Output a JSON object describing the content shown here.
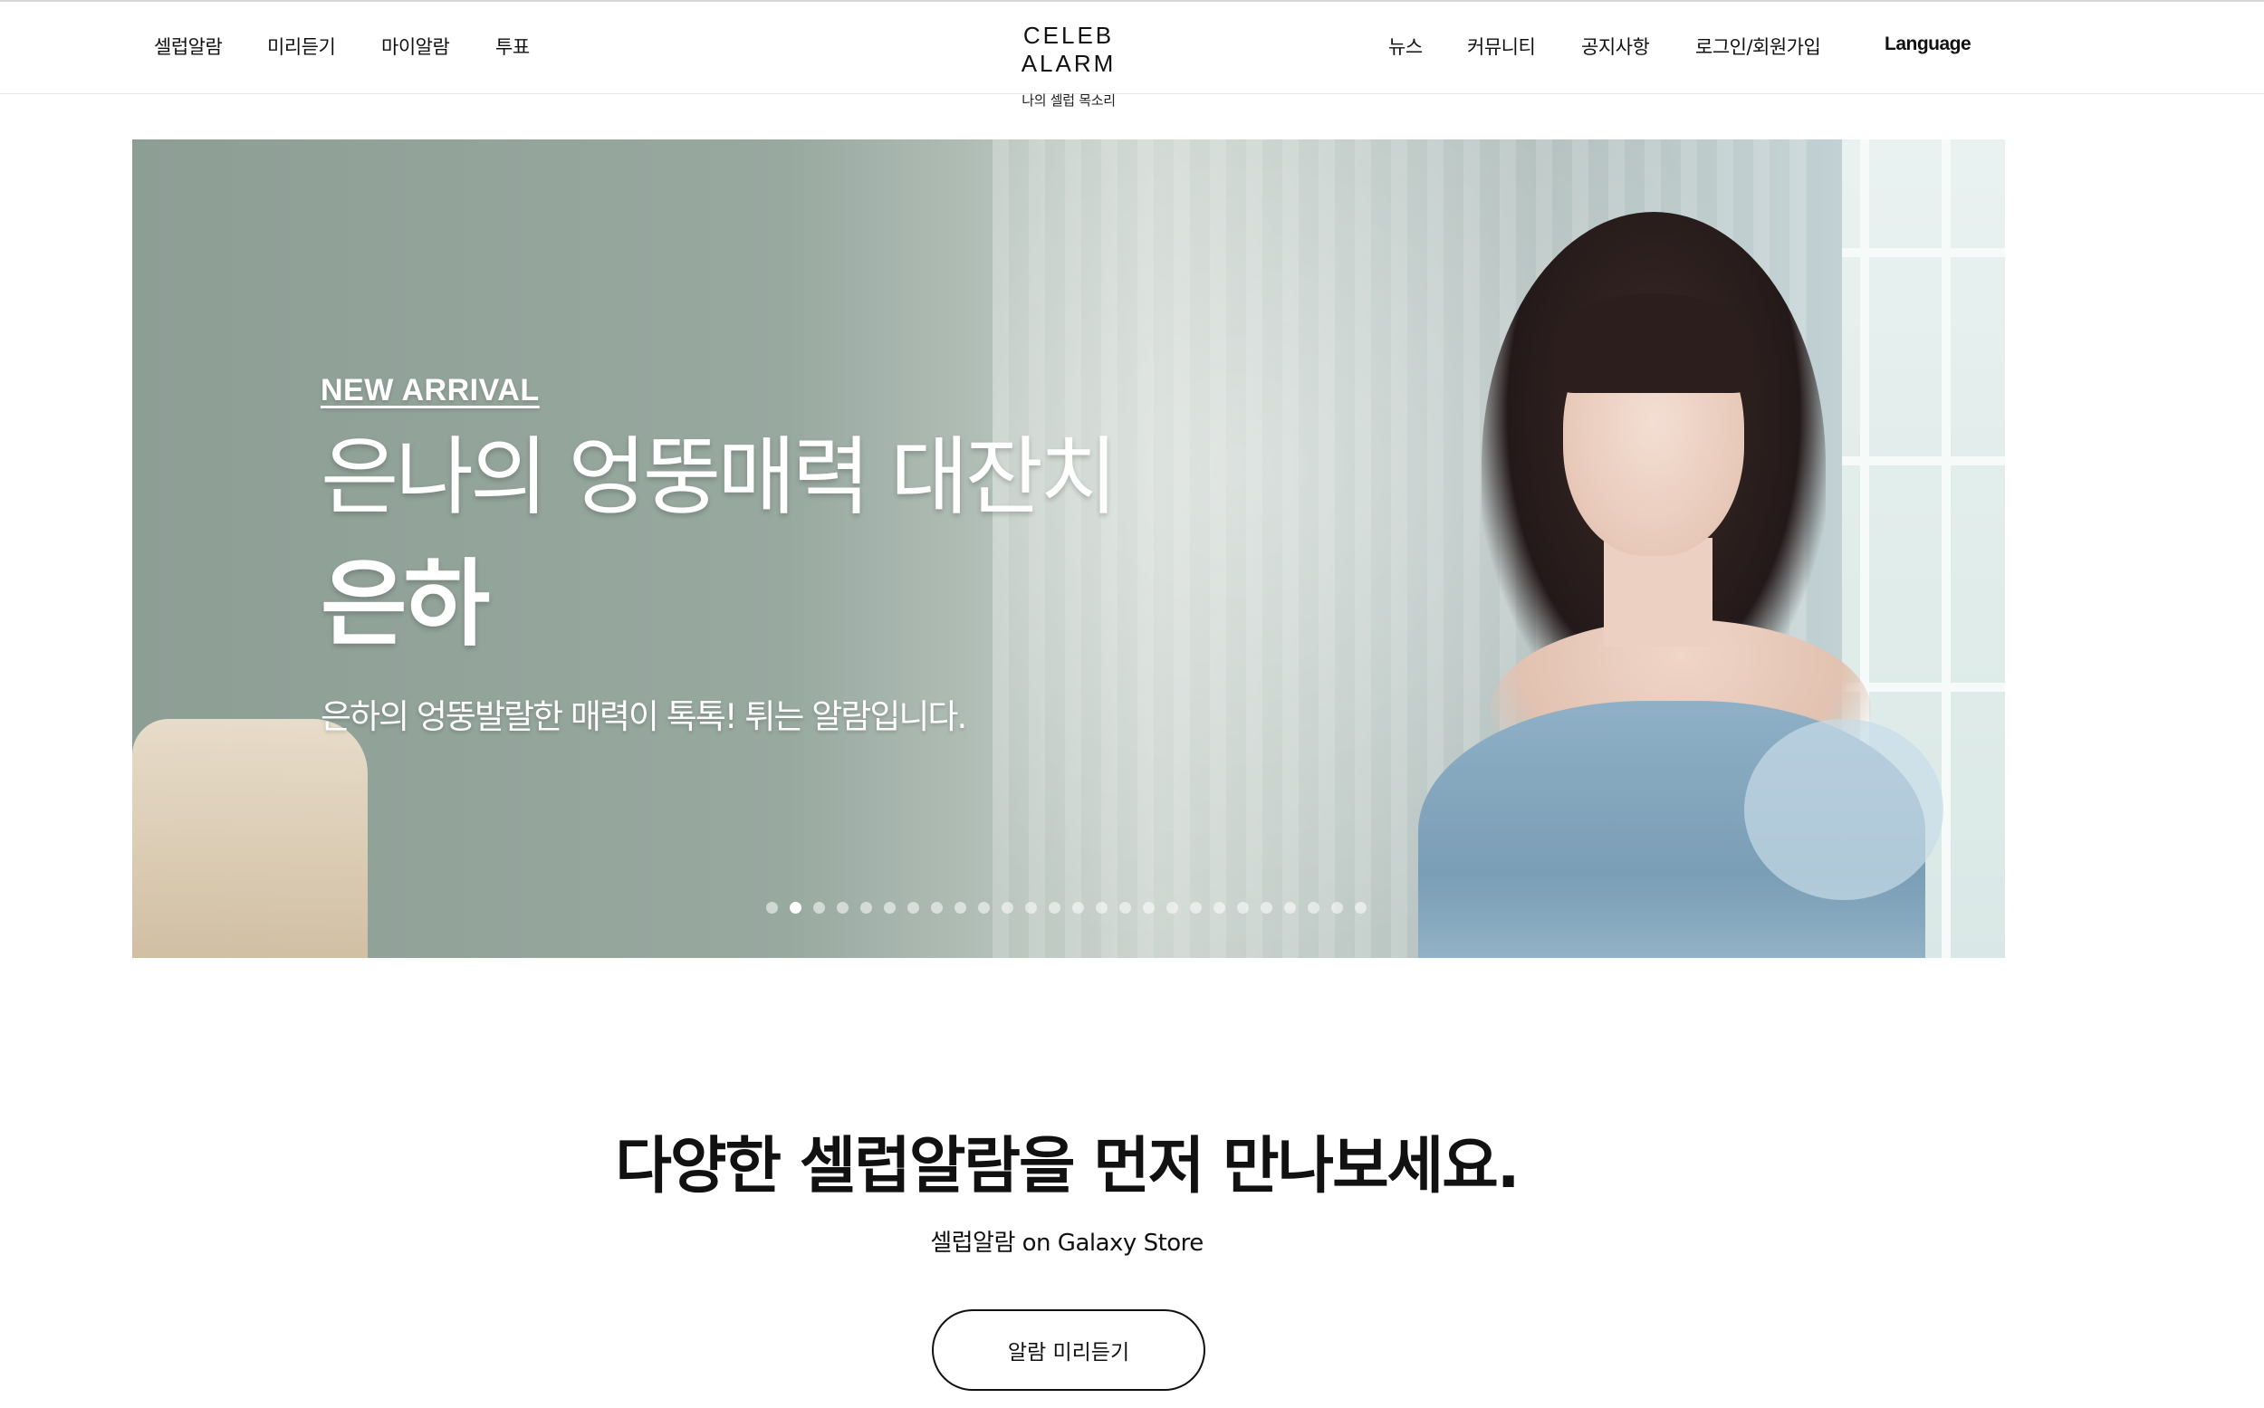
{
  "header": {
    "left_nav": [
      "셀럽알람",
      "미리듣기",
      "마이알람",
      "투표"
    ],
    "logo": "CELEB ALARM",
    "logo_sub": "나의 셀럽 목소리",
    "right_nav": [
      "뉴스",
      "커뮤니티",
      "공지사항",
      "로그인/회원가입"
    ],
    "language": "Language"
  },
  "hero": {
    "tag": "NEW ARRIVAL",
    "headline": "은나의 엉뚱매력 대잔치",
    "name": "은하",
    "description": "은하의 엉뚱발랄한 매력이 톡톡! 튀는 알람입니다.",
    "slide_count": 26,
    "active_slide": 2
  },
  "section": {
    "title": "다양한 셀럽알람을 먼저 만나보세요.",
    "subtitle": "셀럽알람 on Galaxy Store",
    "cta_label": "알람 미리듣기"
  }
}
